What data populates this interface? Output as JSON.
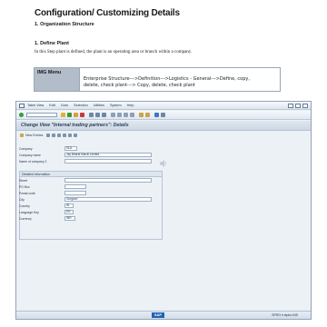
{
  "document": {
    "title": "Configuration/ Customizing Details",
    "section": "1. Organization Structure",
    "step_heading": "1.   Define Plant",
    "step_description": "In this Step plant is defined, the plant is an operating area or branch within a company."
  },
  "img_menu": {
    "label": "IMG Menu",
    "path_line1": "Enterprise Structure--->Definition--->Logistics - General--->Define, copy,",
    "path_line2": "delete, check plant---> Copy, delete, check plant"
  },
  "sap": {
    "menu": [
      "Table View",
      "Edit",
      "Goto",
      "Selection",
      "Utilities",
      "System",
      "Help"
    ],
    "screen_title": "Change View \"Internal trading partners\": Details",
    "new_entries_label": "New Entries",
    "fields": {
      "company_label": "Company",
      "company_value": "5111",
      "company_name_label": "Company name",
      "company_name_value": "Jay Bharat Maruti Limited",
      "name_of_company2_label": "Name of company 2",
      "name_of_company2_value": ""
    },
    "detailed_info": {
      "title": "Detailed information",
      "street_label": "Street",
      "street_value": "",
      "po_box_label": "PO Box",
      "po_box_value": "",
      "postal_code_label": "Postal code",
      "postal_code_value": "",
      "city_label": "City",
      "city_value": "Gurgaon",
      "country_label": "Country",
      "country_value": "IN",
      "language_key_label": "Language Key",
      "language_key_value": "EN",
      "currency_label": "Currency",
      "currency_value": "INR"
    },
    "status": {
      "badge": "SAP",
      "text": "SPRO ▾  iepirs  INS"
    }
  }
}
